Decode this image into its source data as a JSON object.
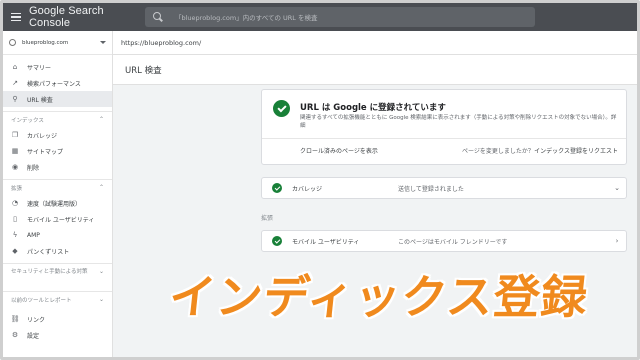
{
  "app": {
    "title": "Google Search Console"
  },
  "search": {
    "placeholder": "「blueproblog.com」内のすべての URL を検査"
  },
  "sidebar": {
    "property": "blueproblog.com",
    "items": [
      {
        "label": "サマリー",
        "icon": "home-icon"
      },
      {
        "label": "検索パフォーマンス",
        "icon": "trend-icon"
      },
      {
        "label": "URL 検査",
        "icon": "search-icon"
      }
    ],
    "index_section": "インデックス",
    "index_items": [
      {
        "label": "カバレッジ",
        "icon": "copy-icon"
      },
      {
        "label": "サイトマップ",
        "icon": "sitemap-icon"
      },
      {
        "label": "削除",
        "icon": "eye-off-icon"
      }
    ],
    "extensions_section": "拡張",
    "extension_items": [
      {
        "label": "速度（試験運用版）",
        "icon": "speed-icon"
      },
      {
        "label": "モバイル ユーザビリティ",
        "icon": "phone-icon"
      },
      {
        "label": "AMP",
        "icon": "bolt-icon"
      },
      {
        "label": "パンくずリスト",
        "icon": "diamond-icon"
      }
    ],
    "security_section": "セキュリティと手動による対策",
    "legacy_section": "以前のツールとレポート",
    "bottom_items": [
      {
        "label": "リンク",
        "icon": "link-icon"
      },
      {
        "label": "設定",
        "icon": "settings-icon"
      }
    ]
  },
  "main": {
    "url": "https://blueproblog.com/",
    "page_title": "URL 検査",
    "status": {
      "title": "URL は Google に登録されています",
      "description": "関連するすべての拡張機能とともに Google 検索結果に表示されます（手動による対策や削除リクエストの対象でない場合）。詳細",
      "crawl_link": "クロール済みのページを表示",
      "changed_question": "ページを変更しましたか？",
      "request_button": "インデックス登録をリクエスト"
    },
    "coverage": {
      "label": "カバレッジ",
      "value": "送信して登録されました"
    },
    "extensions_label": "拡張",
    "usability": {
      "label": "モバイル ユーザビリティ",
      "value": "このページはモバイル フレンドリーです"
    }
  },
  "overlay": {
    "text": "インディックス登録"
  },
  "colors": {
    "topbar": "#4a4d52",
    "success": "#188038",
    "overlay_text": "#f08a1e"
  }
}
